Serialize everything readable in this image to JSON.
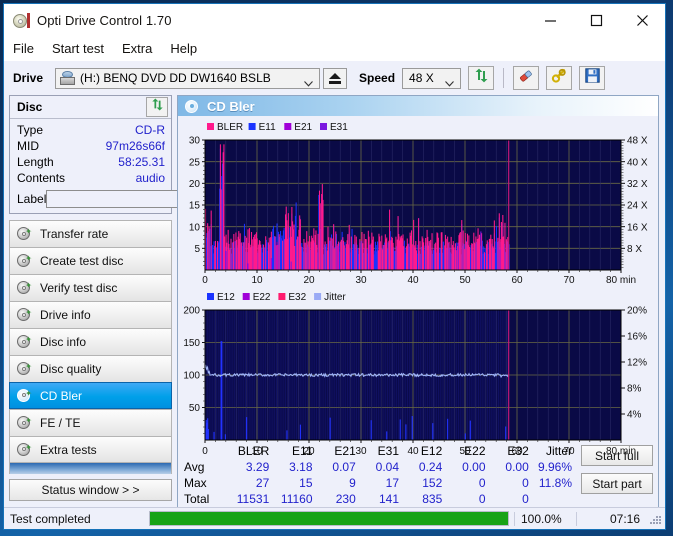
{
  "window": {
    "title": "Opti Drive Control 1.70",
    "icon": "optical-disc-icon",
    "buttons": {
      "minimize": "—",
      "maximize": "□",
      "close": "✕"
    }
  },
  "menu": {
    "items": [
      "File",
      "Start test",
      "Extra",
      "Help"
    ]
  },
  "toolbar": {
    "drive_label": "Drive",
    "drive_value": "(H:)   BENQ DVD DD DW1640 BSLB",
    "eject_title": "Eject",
    "speed_label": "Speed",
    "speed_value": "48 X",
    "refresh_icon": "refresh-icon",
    "erase_icon": "eraser-icon",
    "tools_icon": "tools-icon",
    "save_icon": "save-icon"
  },
  "disc_panel": {
    "title": "Disc",
    "refresh_icon": "refresh-icon",
    "rows": [
      {
        "key": "Type",
        "value": "CD-R"
      },
      {
        "key": "MID",
        "value": "97m26s66f"
      },
      {
        "key": "Length",
        "value": "58:25.31"
      },
      {
        "key": "Contents",
        "value": "audio"
      }
    ],
    "label_key": "Label",
    "label_value": "",
    "label_button_icon": "cd-icon"
  },
  "sidebar": {
    "items": [
      {
        "label": "Transfer rate",
        "selected": false
      },
      {
        "label": "Create test disc",
        "selected": false
      },
      {
        "label": "Verify test disc",
        "selected": false
      },
      {
        "label": "Drive info",
        "selected": false
      },
      {
        "label": "Disc info",
        "selected": false
      },
      {
        "label": "Disc quality",
        "selected": false
      },
      {
        "label": "CD Bler",
        "selected": true
      },
      {
        "label": "FE / TE",
        "selected": false
      },
      {
        "label": "Extra tests",
        "selected": false
      }
    ],
    "status_window_button": "Status window > >"
  },
  "main": {
    "header_title": "CD Bler",
    "header_icon": "disc-scan-icon",
    "start_full": "Start full",
    "start_part": "Start part"
  },
  "chart_data": [
    {
      "type": "line",
      "name": "bler-chart",
      "title": "",
      "xlabel": "min",
      "ylabel": "",
      "xlim": [
        0,
        80
      ],
      "ylim": [
        0,
        30
      ],
      "xticks": [
        0,
        10,
        20,
        30,
        40,
        50,
        60,
        70,
        80
      ],
      "xticklabels": [
        "0",
        "10",
        "20",
        "30",
        "40",
        "50",
        "60",
        "70",
        "80 min"
      ],
      "yticks": [
        5,
        10,
        15,
        20,
        25,
        30
      ],
      "yticklabels": [
        "5",
        "10",
        "15",
        "20",
        "25",
        "30"
      ],
      "y2label": "X",
      "y2lim": [
        0,
        48
      ],
      "y2ticks": [
        8,
        16,
        24,
        32,
        40,
        48
      ],
      "y2ticklabels": [
        "8 X",
        "16 X",
        "24 X",
        "32 X",
        "40 X",
        "48 X"
      ],
      "grid": true,
      "legend": [
        {
          "name": "BLER",
          "color": "#ff1a8c"
        },
        {
          "name": "E11",
          "color": "#1a33ff"
        },
        {
          "name": "E21",
          "color": "#a000d8"
        },
        {
          "name": "E31",
          "color": "#7a18e0"
        }
      ],
      "plot_bg": "#0a0a46",
      "data_end_min": 58.4,
      "series": [
        {
          "name": "BLER",
          "color": "#ff1a8c",
          "avg": 3.29,
          "max": 27,
          "total": 11531
        },
        {
          "name": "E11",
          "color": "#1a33ff",
          "avg": 3.18,
          "max": 15,
          "total": 11160
        },
        {
          "name": "E21",
          "color": "#a000d8",
          "avg": 0.07,
          "max": 9,
          "total": 230
        },
        {
          "name": "E31",
          "color": "#7a18e0",
          "avg": 0.04,
          "max": 17,
          "total": 141
        }
      ]
    },
    {
      "type": "line",
      "name": "jitter-chart",
      "title": "",
      "xlabel": "min",
      "ylabel": "",
      "xlim": [
        0,
        80
      ],
      "ylim": [
        0,
        200
      ],
      "xticks": [
        0,
        10,
        20,
        30,
        40,
        50,
        60,
        70,
        80
      ],
      "xticklabels": [
        "0",
        "10",
        "20",
        "30",
        "40",
        "50",
        "60",
        "70",
        "80 min"
      ],
      "yticks": [
        50,
        100,
        150,
        200
      ],
      "yticklabels": [
        "50",
        "100",
        "150",
        "200"
      ],
      "y2lim": [
        0,
        20
      ],
      "y2ticks": [
        4,
        8,
        12,
        16,
        20
      ],
      "y2ticklabels": [
        "4%",
        "8%",
        "12%",
        "16%",
        "20%"
      ],
      "grid": true,
      "legend": [
        {
          "name": "E12",
          "color": "#1a33ff"
        },
        {
          "name": "E22",
          "color": "#a000d8"
        },
        {
          "name": "E32",
          "color": "#ff1a6e"
        },
        {
          "name": "Jitter",
          "color": "#9aaaf5"
        }
      ],
      "plot_bg": "#0a0a46",
      "data_end_min": 58.4,
      "jitter_avg_pct": 9.96,
      "jitter_max_pct": 11.8,
      "series": [
        {
          "name": "E12",
          "color": "#1a33ff",
          "avg": 0.24,
          "max": 152,
          "total": 835
        },
        {
          "name": "E22",
          "color": "#a000d8",
          "avg": 0.0,
          "max": 0,
          "total": 0
        },
        {
          "name": "E32",
          "color": "#ff1a6e",
          "avg": 0.0,
          "max": 0,
          "total": 0
        },
        {
          "name": "Jitter",
          "color": "#9aaaf5",
          "avg": "9.96%",
          "max": "11.8%",
          "total": ""
        }
      ]
    }
  ],
  "stats": {
    "columns": [
      "",
      "BLER",
      "E11",
      "E21",
      "E31",
      "E12",
      "E22",
      "E32",
      "Jitter"
    ],
    "rows": [
      {
        "label": "Avg",
        "values": [
          "3.29",
          "3.18",
          "0.07",
          "0.04",
          "0.24",
          "0.00",
          "0.00",
          "9.96%"
        ]
      },
      {
        "label": "Max",
        "values": [
          "27",
          "15",
          "9",
          "17",
          "152",
          "0",
          "0",
          "11.8%"
        ]
      },
      {
        "label": "Total",
        "values": [
          "11531",
          "11160",
          "230",
          "141",
          "835",
          "0",
          "0",
          ""
        ]
      }
    ]
  },
  "statusbar": {
    "message": "Test completed",
    "progress_percent": "100.0%",
    "progress_value": 100,
    "elapsed": "07:16"
  }
}
